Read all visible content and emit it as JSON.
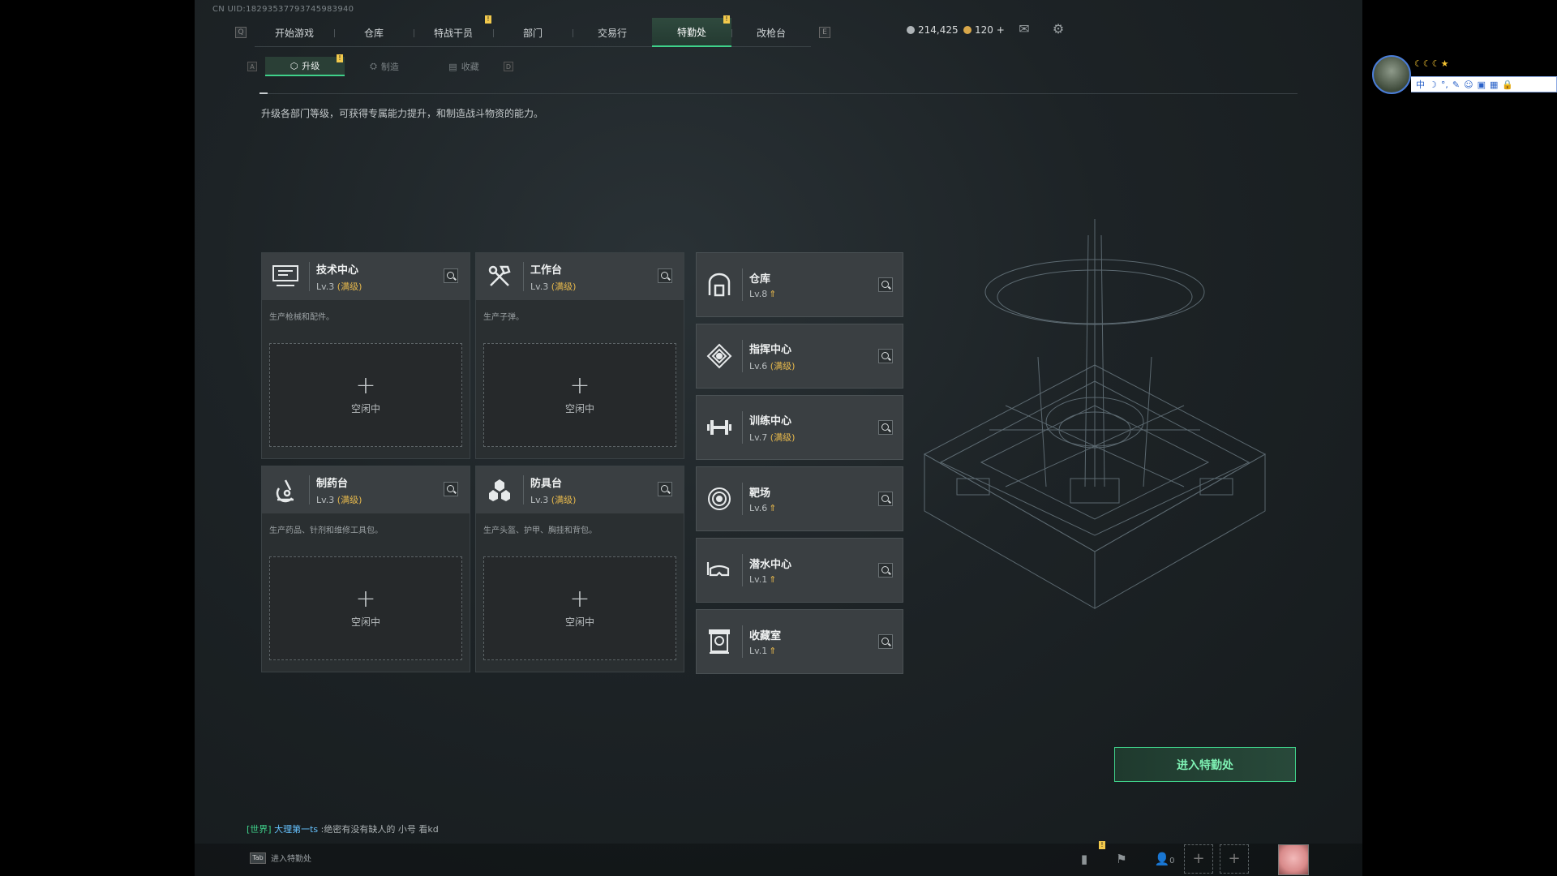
{
  "uid": "CN UID:18293537793745983940",
  "nav": {
    "left_key": "Q",
    "right_key": "E",
    "tabs": [
      {
        "label": "开始游戏",
        "marker": false
      },
      {
        "label": "仓库",
        "marker": false
      },
      {
        "label": "特战干员",
        "marker": true
      },
      {
        "label": "部门",
        "marker": false
      },
      {
        "label": "交易行",
        "marker": false
      },
      {
        "label": "特勤处",
        "marker": true,
        "active": true
      },
      {
        "label": "改枪台",
        "marker": false
      }
    ]
  },
  "resources": {
    "silver": "214,425",
    "gold": "120 +"
  },
  "subnav": {
    "left_key": "A",
    "right_key": "D",
    "tabs": [
      {
        "label": "升级",
        "active": true,
        "marker": true
      },
      {
        "label": "制造",
        "active": false
      },
      {
        "label": "收藏",
        "active": false
      }
    ]
  },
  "description": "升级各部门等级，可获得专属能力提升，和制造战斗物资的能力。",
  "max_label": "(满级)",
  "cards": [
    {
      "title": "技术中心",
      "lv": "Lv.3",
      "desc": "生产枪械和配件。",
      "slot": "空闲中",
      "icon": "computer-icon"
    },
    {
      "title": "工作台",
      "lv": "Lv.3",
      "desc": "生产子弹。",
      "slot": "空闲中",
      "icon": "tools-icon"
    },
    {
      "title": "制药台",
      "lv": "Lv.3",
      "desc": "生产药品、针剂和维修工具包。",
      "slot": "空闲中",
      "icon": "microscope-icon"
    },
    {
      "title": "防具台",
      "lv": "Lv.3",
      "desc": "生产头盔、护甲、胸挂和背包。",
      "slot": "空闲中",
      "icon": "armor-icon"
    }
  ],
  "depts": [
    {
      "title": "仓库",
      "lv": "Lv.8",
      "max": false,
      "icon": "warehouse-icon"
    },
    {
      "title": "指挥中心",
      "lv": "Lv.6",
      "max": true,
      "icon": "command-icon"
    },
    {
      "title": "训练中心",
      "lv": "Lv.7",
      "max": true,
      "icon": "dumbbell-icon"
    },
    {
      "title": "靶场",
      "lv": "Lv.6",
      "max": false,
      "icon": "target-icon"
    },
    {
      "title": "潜水中心",
      "lv": "Lv.1",
      "max": false,
      "icon": "diving-mask-icon"
    },
    {
      "title": "收藏室",
      "lv": "Lv.1",
      "max": false,
      "icon": "trophy-icon"
    }
  ],
  "enter_button": "进入特勤处",
  "chat": {
    "channel": "[世界]",
    "name": "大理第一ts",
    "message": ":绝密有没有缺人的 小号 看kd"
  },
  "bottom": {
    "tab_key": "Tab",
    "tab_label": "进入特勤处",
    "friends_count": "0"
  },
  "colors": {
    "accent": "#3fd18a",
    "max_level": "#e6b84c",
    "marker": "#f2c94c"
  }
}
